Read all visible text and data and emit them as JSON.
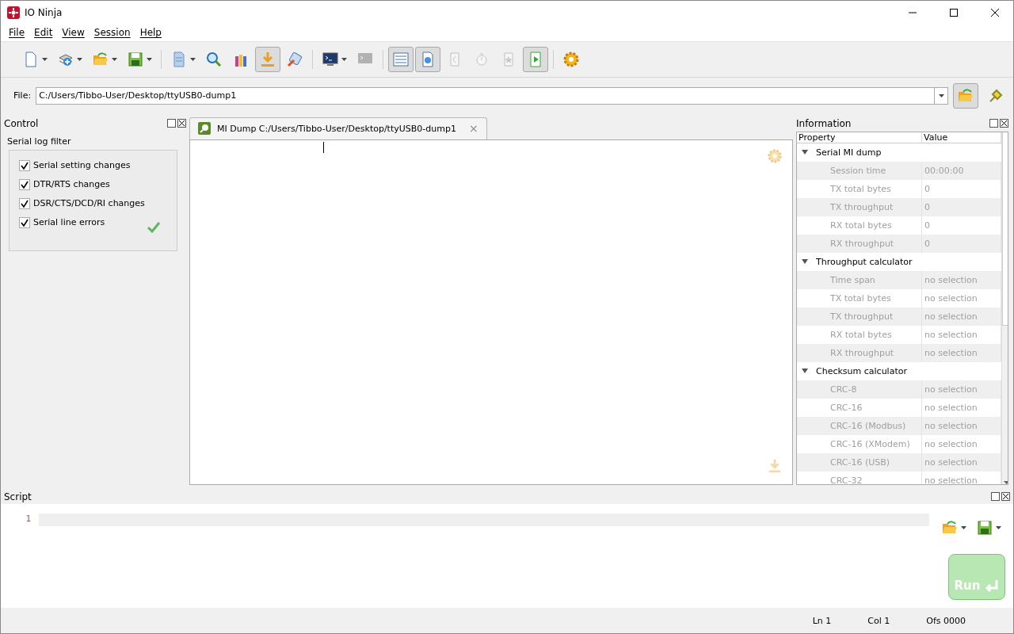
{
  "window": {
    "title": "IO Ninja"
  },
  "menu": [
    "File",
    "Edit",
    "View",
    "Session",
    "Help"
  ],
  "toolbar": [
    {
      "dropdown": true,
      "pressed": false,
      "disabled": false
    },
    {
      "dropdown": true,
      "pressed": false,
      "disabled": false
    },
    {
      "dropdown": true,
      "pressed": false,
      "disabled": false
    },
    {
      "dropdown": true,
      "pressed": false,
      "disabled": false
    },
    {
      "separator": true
    },
    {
      "dropdown": true,
      "pressed": false,
      "disabled": false
    },
    {
      "dropdown": false,
      "pressed": false,
      "disabled": false
    },
    {
      "dropdown": false,
      "pressed": false,
      "disabled": false
    },
    {
      "dropdown": false,
      "pressed": true,
      "disabled": false
    },
    {
      "dropdown": false,
      "pressed": false,
      "disabled": false
    },
    {
      "separator": true
    },
    {
      "dropdown": true,
      "pressed": false,
      "disabled": false
    },
    {
      "dropdown": false,
      "pressed": false,
      "disabled": true
    },
    {
      "separator": true
    },
    {
      "dropdown": false,
      "pressed": true,
      "disabled": false
    },
    {
      "dropdown": false,
      "pressed": true,
      "disabled": false
    },
    {
      "dropdown": false,
      "pressed": false,
      "disabled": true
    },
    {
      "dropdown": false,
      "pressed": false,
      "disabled": true
    },
    {
      "dropdown": false,
      "pressed": false,
      "disabled": true
    },
    {
      "dropdown": false,
      "pressed": true,
      "disabled": false
    },
    {
      "separator": true
    },
    {
      "dropdown": false,
      "pressed": false,
      "disabled": false
    }
  ],
  "file_bar": {
    "label": "File:",
    "value": "C:/Users/Tibbo-User/Desktop/ttyUSB0-dump1"
  },
  "control_panel": {
    "title": "Control",
    "group_title": "Serial log filter",
    "options": [
      {
        "label": "Serial setting changes",
        "checked": true
      },
      {
        "label": "DTR/RTS changes",
        "checked": true
      },
      {
        "label": "DSR/CTS/DCD/RI changes",
        "checked": true
      },
      {
        "label": "Serial line errors",
        "checked": true
      }
    ]
  },
  "tabs": [
    {
      "label": "MI Dump C:/Users/Tibbo-User/Desktop/ttyUSB0-dump1",
      "close": "×",
      "selected": true
    }
  ],
  "information_panel": {
    "title": "Information",
    "columns": [
      "Property",
      "Value"
    ],
    "groups": [
      {
        "name": "Serial MI dump",
        "expanded": true,
        "children": [
          {
            "property": "Session time",
            "value": "00:00:00"
          },
          {
            "property": "TX total bytes",
            "value": "0"
          },
          {
            "property": "TX throughput",
            "value": "0"
          },
          {
            "property": "RX total bytes",
            "value": "0"
          },
          {
            "property": "RX throughput",
            "value": "0"
          }
        ]
      },
      {
        "name": "Throughput calculator",
        "expanded": true,
        "children": [
          {
            "property": "Time span",
            "value": "no selection"
          },
          {
            "property": "TX total bytes",
            "value": "no selection"
          },
          {
            "property": "TX throughput",
            "value": "no selection"
          },
          {
            "property": "RX total bytes",
            "value": "no selection"
          },
          {
            "property": "RX throughput",
            "value": "no selection"
          }
        ]
      },
      {
        "name": "Checksum calculator",
        "expanded": true,
        "children": [
          {
            "property": "CRC-8",
            "value": "no selection"
          },
          {
            "property": "CRC-16",
            "value": "no selection"
          },
          {
            "property": "CRC-16 (Modbus)",
            "value": "no selection"
          },
          {
            "property": "CRC-16 (XModem)",
            "value": "no selection"
          },
          {
            "property": "CRC-16 (USB)",
            "value": "no selection"
          },
          {
            "property": "CRC-32",
            "value": "no selection"
          }
        ]
      }
    ]
  },
  "script_panel": {
    "title": "Script",
    "line_number": "1",
    "run_label": "Run"
  },
  "status_bar": [
    "Ln 1",
    "Col 1",
    "Ofs 0000"
  ]
}
